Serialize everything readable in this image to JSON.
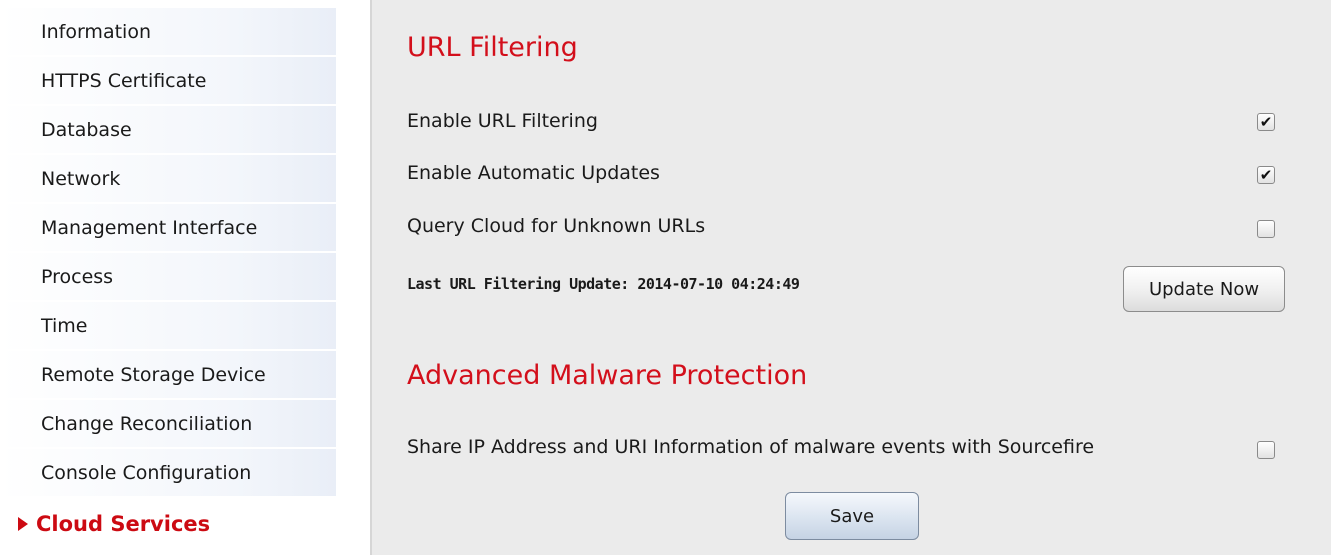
{
  "sidebar": {
    "items": [
      {
        "label": "Information"
      },
      {
        "label": "HTTPS Certificate"
      },
      {
        "label": "Database"
      },
      {
        "label": "Network"
      },
      {
        "label": "Management Interface"
      },
      {
        "label": "Process"
      },
      {
        "label": "Time"
      },
      {
        "label": "Remote Storage Device"
      },
      {
        "label": "Change Reconciliation"
      },
      {
        "label": "Console Configuration"
      },
      {
        "label": "Cloud Services",
        "active": true
      }
    ]
  },
  "url_filtering": {
    "title": "URL Filtering",
    "enable_label": "Enable URL Filtering",
    "enable_checked": true,
    "auto_updates_label": "Enable Automatic Updates",
    "auto_updates_checked": true,
    "query_cloud_label": "Query Cloud for Unknown URLs",
    "query_cloud_checked": false,
    "last_update_text": "Last URL Filtering Update: 2014-07-10 04:24:49",
    "update_now_label": "Update Now"
  },
  "amp": {
    "title": "Advanced Malware Protection",
    "share_label": "Share IP Address and URI Information of malware events with Sourcefire",
    "share_checked": false
  },
  "save_label": "Save",
  "check_glyph": "✔",
  "colors": {
    "accent_red": "#d30f1b",
    "content_bg": "#ebebeb"
  }
}
